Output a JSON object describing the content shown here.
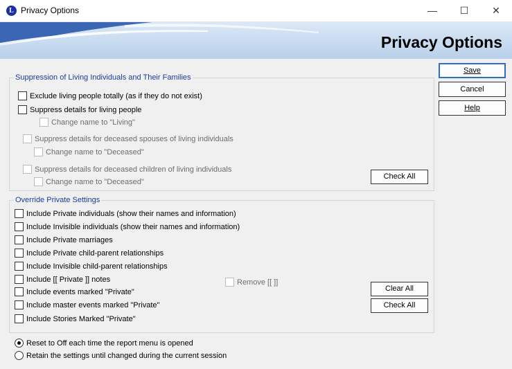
{
  "window": {
    "title": "Privacy Options",
    "icon_letter": "L"
  },
  "banner": {
    "title": "Privacy Options"
  },
  "suppression": {
    "legend": "Suppression of Living Individuals and Their Families",
    "items": [
      {
        "label": "Exclude living people totally (as if they do not exist)",
        "checked": false,
        "enabled": true
      },
      {
        "label": "Suppress details for living people",
        "checked": false,
        "enabled": true
      },
      {
        "label": "Change name to \"Living\"",
        "checked": false,
        "enabled": false
      },
      {
        "label": "Suppress details for deceased spouses of living individuals",
        "checked": false,
        "enabled": false
      },
      {
        "label": "Change name to \"Deceased\"",
        "checked": false,
        "enabled": false
      },
      {
        "label": "Suppress details for deceased children of living individuals",
        "checked": false,
        "enabled": false
      },
      {
        "label": "Change name to \"Deceased\"",
        "checked": false,
        "enabled": false
      }
    ],
    "check_all": "Check All"
  },
  "override": {
    "legend": "Override Private Settings",
    "items": [
      {
        "label": "Include Private individuals (show their names and information)",
        "checked": false
      },
      {
        "label": "Include Invisible individuals (show their names and information)",
        "checked": false
      },
      {
        "label": "Include Private marriages",
        "checked": false
      },
      {
        "label": "Include Private child-parent relationships",
        "checked": false
      },
      {
        "label": "Include Invisible child-parent relationships",
        "checked": false
      },
      {
        "label": "Include [[ Private ]] notes",
        "checked": false
      },
      {
        "label": "Include events marked \"Private\"",
        "checked": false
      },
      {
        "label": "Include master events marked \"Private\"",
        "checked": false
      },
      {
        "label": "Include Stories Marked \"Private\"",
        "checked": false
      }
    ],
    "remove_label": "Remove [[  ]]",
    "clear_all": "Clear All",
    "check_all": "Check All"
  },
  "buttons": {
    "save": "Save",
    "cancel": "Cancel",
    "help": "Help"
  },
  "reset_options": [
    {
      "label": "Reset to Off each time the report menu is opened",
      "selected": true
    },
    {
      "label": "Retain the settings until changed during the current session",
      "selected": false
    }
  ],
  "colors": {
    "legend": "#1a3a9c",
    "banner": "#c8dcf0",
    "default_button_border": "#2e6cd1"
  }
}
